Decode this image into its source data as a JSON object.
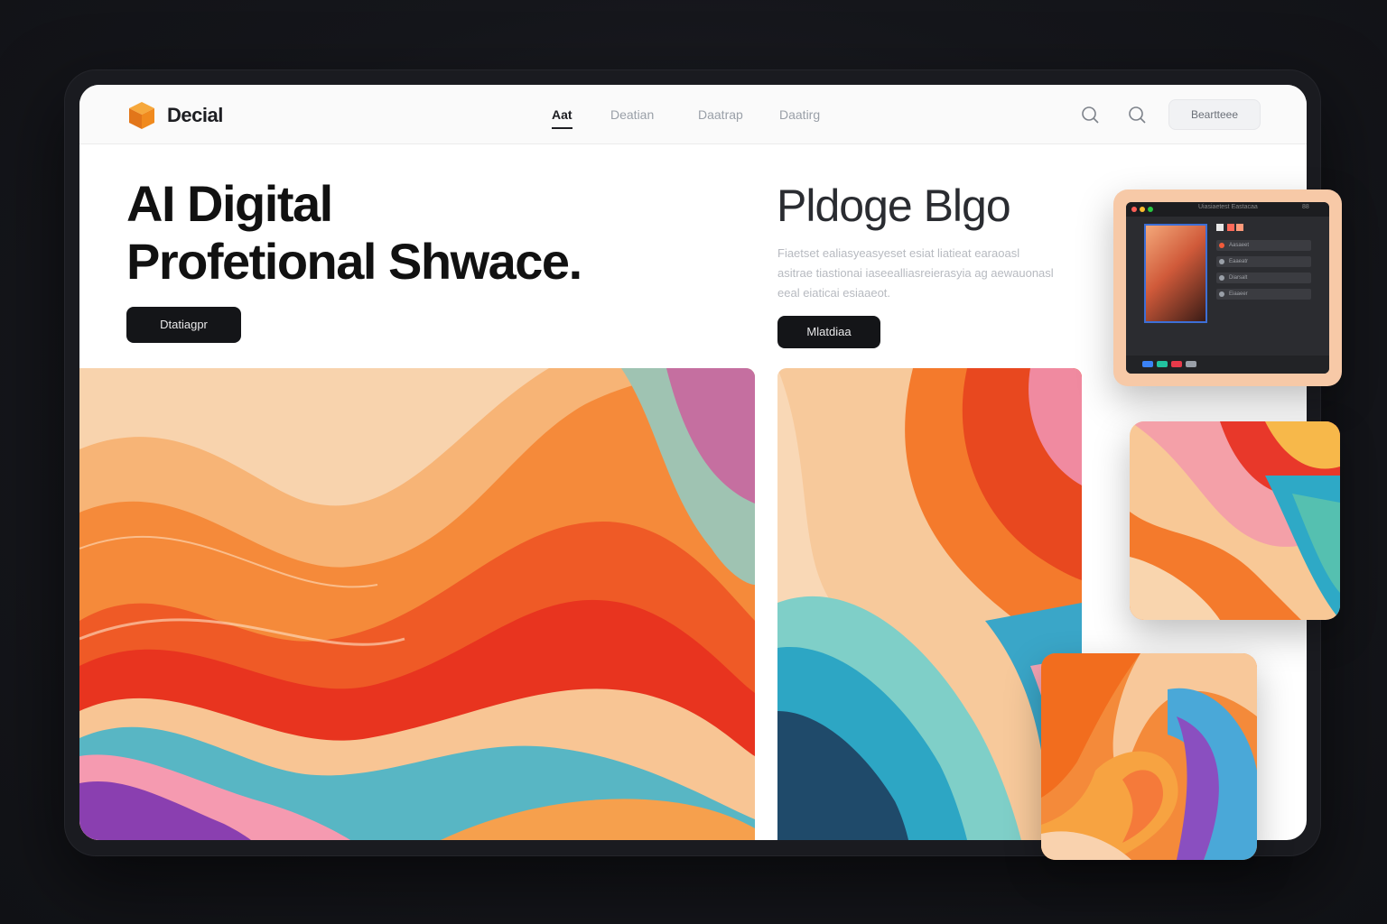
{
  "brand": {
    "name": "Decial",
    "logo_icon": "cube-icon",
    "accent": "#f08a1e"
  },
  "nav": {
    "items": [
      {
        "label": "Aat",
        "active": true
      },
      {
        "label": "Deatian",
        "active": false
      },
      {
        "label": "Daatrap",
        "active": false
      },
      {
        "label": "Daatirg",
        "active": false
      }
    ],
    "search_icon_1": "search-icon",
    "search_icon_2": "search-icon",
    "pill_label": "Beartteee"
  },
  "hero": {
    "title_line1": "AI Digital",
    "title_line2": "Profetional Shwace.",
    "cta_label": "Dtatiagpr"
  },
  "blog": {
    "title": "Pldoge Blgo",
    "description": "Fiaetset ealiasyeasyeset esiat liatieat earaoasl asitrae tiastionai iaseealliasreierasyia ag aewauonasl eeal eiaticai esiaaeot.",
    "cta_label": "Mlatdiaa"
  },
  "editor": {
    "title": "Uiasiaetest Eastacaa",
    "zoom": "88",
    "layers": [
      "Aasaeet",
      "Eaaeatr",
      "Diarsalt",
      "Eiaaeer"
    ]
  },
  "colors": {
    "dark_button": "#141518",
    "orange": "#f26d1e",
    "peach": "#f8d2ae",
    "teal": "#3fb7c8",
    "red": "#e73a2a"
  }
}
